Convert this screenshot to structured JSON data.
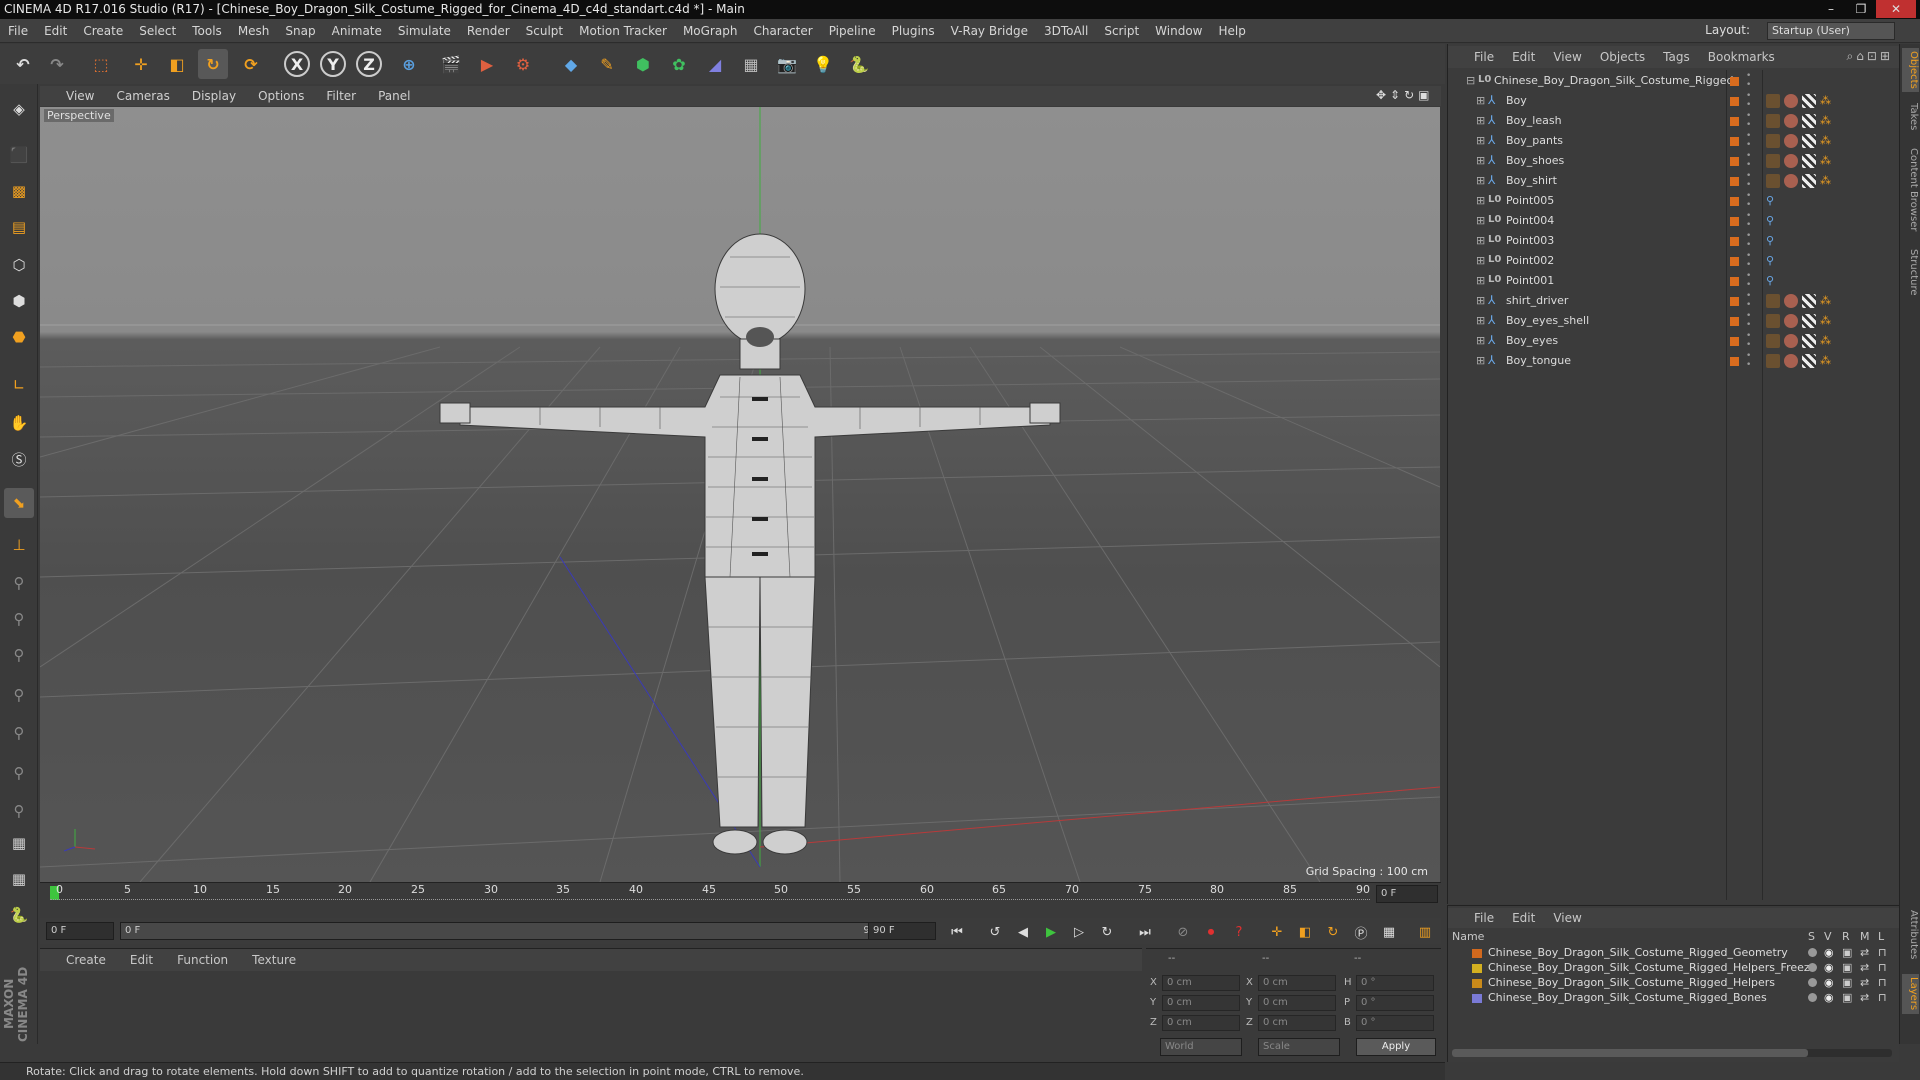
{
  "window": {
    "title": "CINEMA 4D R17.016 Studio (R17) - [Chinese_Boy_Dragon_Silk_Costume_Rigged_for_Cinema_4D_c4d_standart.c4d *] - Main",
    "minimize": "–",
    "maximize": "❐",
    "close": "✕"
  },
  "menubar": [
    "File",
    "Edit",
    "Create",
    "Select",
    "Tools",
    "Mesh",
    "Snap",
    "Animate",
    "Simulate",
    "Render",
    "Sculpt",
    "Motion Tracker",
    "MoGraph",
    "Character",
    "Pipeline",
    "Plugins",
    "V-Ray Bridge",
    "3DToAll",
    "Script",
    "Window",
    "Help"
  ],
  "layout": {
    "label": "Layout:",
    "value": "Startup (User)"
  },
  "viewport": {
    "menu": [
      "View",
      "Cameras",
      "Display",
      "Options",
      "Filter",
      "Panel"
    ],
    "label": "Perspective",
    "grid_spacing": "Grid Spacing : 100 cm"
  },
  "timeline": {
    "ticks": [
      "0",
      "5",
      "10",
      "15",
      "20",
      "25",
      "30",
      "35",
      "40",
      "45",
      "50",
      "55",
      "60",
      "65",
      "70",
      "75",
      "80",
      "85",
      "90"
    ],
    "current_frame_right": "0 F",
    "start_field": "0 F",
    "range_start": "0 F",
    "range_end": "90 F",
    "end_field": "90 F"
  },
  "material_panel": {
    "menu": [
      "Create",
      "Edit",
      "Function",
      "Texture"
    ]
  },
  "coords": {
    "header_left": "--",
    "header_mid": "--",
    "header_right": "--",
    "rows": [
      {
        "axis": "X",
        "pos": "0 cm",
        "axis2": "X",
        "size": "0 cm",
        "rot_label": "H",
        "rot": "0 °"
      },
      {
        "axis": "Y",
        "pos": "0 cm",
        "axis2": "Y",
        "size": "0 cm",
        "rot_label": "P",
        "rot": "0 °"
      },
      {
        "axis": "Z",
        "pos": "0 cm",
        "axis2": "Z",
        "size": "0 cm",
        "rot_label": "B",
        "rot": "0 °"
      }
    ],
    "mode": "World",
    "size_mode": "Scale",
    "apply": "Apply"
  },
  "status": "Rotate: Click and drag to rotate elements. Hold down SHIFT to add to quantize rotation / add to the selection in point mode, CTRL to remove.",
  "object_manager": {
    "menu": [
      "File",
      "Edit",
      "View",
      "Objects",
      "Tags",
      "Bookmarks"
    ],
    "root": "Chinese_Boy_Dragon_Silk_Costume_Rigged",
    "objects": [
      {
        "name": "Boy",
        "type": "joint"
      },
      {
        "name": "Boy_leash",
        "type": "joint"
      },
      {
        "name": "Boy_pants",
        "type": "joint"
      },
      {
        "name": "Boy_shoes",
        "type": "joint"
      },
      {
        "name": "Boy_shirt",
        "type": "joint"
      },
      {
        "name": "Point005",
        "type": "null"
      },
      {
        "name": "Point004",
        "type": "null"
      },
      {
        "name": "Point003",
        "type": "null"
      },
      {
        "name": "Point002",
        "type": "null"
      },
      {
        "name": "Point001",
        "type": "null"
      },
      {
        "name": "shirt_driver",
        "type": "joint"
      },
      {
        "name": "Boy_eyes_shell",
        "type": "joint"
      },
      {
        "name": "Boy_eyes",
        "type": "joint"
      },
      {
        "name": "Boy_tongue",
        "type": "joint"
      }
    ]
  },
  "layer_manager": {
    "menu": [
      "File",
      "Edit",
      "View"
    ],
    "columns": {
      "name": "Name",
      "s": "S",
      "v": "V",
      "r": "R",
      "m": "M",
      "l": "L"
    },
    "layers": [
      {
        "name": "Chinese_Boy_Dragon_Silk_Costume_Rigged_Geometry",
        "color": "#d2691e"
      },
      {
        "name": "Chinese_Boy_Dragon_Silk_Costume_Rigged_Helpers_Freeze",
        "color": "#d4b020"
      },
      {
        "name": "Chinese_Boy_Dragon_Silk_Costume_Rigged_Helpers",
        "color": "#c98a1a"
      },
      {
        "name": "Chinese_Boy_Dragon_Silk_Costume_Rigged_Bones",
        "color": "#7a7ad6"
      }
    ]
  },
  "right_tabs": [
    "Objects",
    "Takes",
    "Content Browser",
    "Structure",
    "Attributes",
    "Layers"
  ],
  "maxon_logo": "MAXON CINEMA 4D"
}
